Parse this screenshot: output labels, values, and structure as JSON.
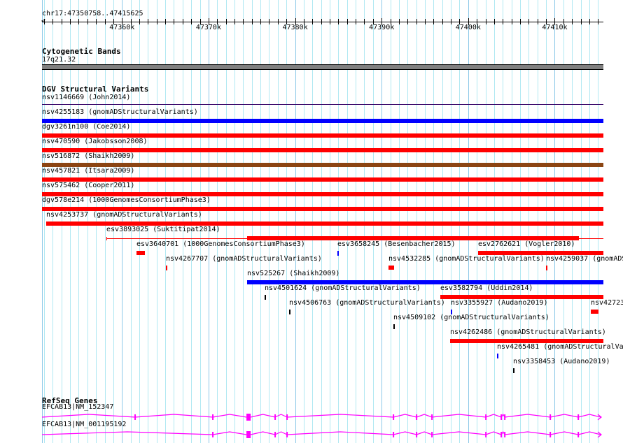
{
  "location": "chr17:47350758..47415625",
  "view": {
    "start": 47350758,
    "end": 47415625
  },
  "ruler": {
    "tick_labels": [
      "47360k",
      "47370k",
      "47380k",
      "47390k",
      "47400k",
      "47410k"
    ],
    "ticks_bp": [
      47360000,
      47370000,
      47380000,
      47390000,
      47400000,
      47410000
    ]
  },
  "colors": {
    "red": "#ff0000",
    "blue": "#0000ff",
    "brown": "#8b4513",
    "black": "#000000",
    "gray": "#808080",
    "gene": "#ff00ff",
    "thin": "#330066"
  },
  "cytoband": {
    "title": "Cytogenetic Bands",
    "band": "17q21.32"
  },
  "dgv": {
    "title": "DGV Structural Variants",
    "features": [
      {
        "label": "nsv1146669 (John2014)",
        "start": 47350758,
        "end": 47415625,
        "row": 0,
        "color": "thin",
        "style": "line"
      },
      {
        "label": "nsv4255183 (gnomADStructuralVariants)",
        "start": 47350758,
        "end": 47415625,
        "row": 1,
        "color": "blue"
      },
      {
        "label": "dgv3261n100 (Coe2014)",
        "start": 47350758,
        "end": 47415625,
        "row": 2,
        "color": "red"
      },
      {
        "label": "nsv470590 (Jakobsson2008)",
        "start": 47350758,
        "end": 47415625,
        "row": 3,
        "color": "red"
      },
      {
        "label": "nsv516872 (Shaikh2009)",
        "start": 47350758,
        "end": 47415625,
        "row": 4,
        "color": "brown"
      },
      {
        "label": "nsv457821 (Itsara2009)",
        "start": 47350758,
        "end": 47415625,
        "row": 5,
        "color": "red"
      },
      {
        "label": "nsv575462 (Cooper2011)",
        "start": 47350758,
        "end": 47415625,
        "row": 6,
        "color": "red"
      },
      {
        "label": "dgv578e214 (1000GenomesConsortiumPhase3)",
        "start": 47350758,
        "end": 47415625,
        "row": 7,
        "color": "red"
      },
      {
        "label": "nsv4253737 (gnomADStructuralVariants)",
        "start": 47351243,
        "end": 47415625,
        "row": 8,
        "color": "red"
      },
      {
        "label": "esv3893025 (Suktitipat2014)",
        "start": 47358201,
        "end": 47415625,
        "thick_start": 47374462,
        "thick_end": 47412808,
        "row": 9,
        "color": "red",
        "style": "thickthin"
      },
      {
        "label": "esv3640701 (1000GenomesConsortiumPhase3)",
        "start": 47361680,
        "end": 47362650,
        "row": 10,
        "color": "red"
      },
      {
        "label": "esv3658245 (Besenbacher2015)",
        "start": 47384898,
        "end": 47385060,
        "row": 10,
        "color": "blue"
      },
      {
        "label": "esv2762621 (Vogler2010)",
        "start": 47401159,
        "end": 47415625,
        "row": 10,
        "color": "red"
      },
      {
        "label": "nsv4267707 (gnomADStructuralVariants)",
        "start": 47365077,
        "end": 47365239,
        "row": 11,
        "color": "red"
      },
      {
        "label": "nsv4532285 (gnomADStructuralVariants)",
        "start": 47390804,
        "end": 47391451,
        "row": 11,
        "color": "red"
      },
      {
        "label": "nsv4259037 (gnomADS",
        "start": 47409006,
        "end": 47409168,
        "row": 11,
        "color": "red"
      },
      {
        "label": "nsv525267 (Shaikh2009)",
        "start": 47374462,
        "end": 47415625,
        "row": 12,
        "color": "blue"
      },
      {
        "label": "nsv4501624 (gnomADStructuralVariants)",
        "start": 47376484,
        "end": 47376646,
        "row": 13,
        "color": "black"
      },
      {
        "label": "esv3582794 (Uddin2014)",
        "start": 47396790,
        "end": 47415625,
        "row": 13,
        "color": "red"
      },
      {
        "label": "nsv4506763 (gnomADStructuralVariants)",
        "start": 47379316,
        "end": 47379478,
        "row": 14,
        "color": "black"
      },
      {
        "label": "nsv3355927 (Audano2019)",
        "start": 47398004,
        "end": 47398166,
        "row": 14,
        "color": "blue"
      },
      {
        "label": "nsv42723",
        "start": 47414184,
        "end": 47415074,
        "row": 14,
        "color": "red"
      },
      {
        "label": "nsv4509102 (gnomADStructuralVariants)",
        "start": 47391370,
        "end": 47391532,
        "row": 15,
        "color": "black"
      },
      {
        "label": "nsv4262486 (gnomADStructuralVariants)",
        "start": 47397923,
        "end": 47415625,
        "row": 16,
        "color": "red"
      },
      {
        "label": "nsv4265481 (gnomADStructuralVa",
        "start": 47403343,
        "end": 47403505,
        "row": 17,
        "color": "blue"
      },
      {
        "label": "nsv3358453 (Audano2019)",
        "start": 47405204,
        "end": 47405366,
        "row": 18,
        "color": "black"
      }
    ]
  },
  "refseq": {
    "title": "RefSeq Genes",
    "transcripts": [
      {
        "label": "EFCAB13|NM_152347",
        "start": 47350758,
        "end": 47415300,
        "exons": [
          47361518,
          47370498,
          [
            47374381,
            47374866
          ],
          47377698,
          47379073,
          47391370,
          47394040,
          47395819,
          47402049,
          47403828,
          47404233,
          47409491,
          47412727
        ]
      },
      {
        "label": "EFCAB13|NM_001195192",
        "start": 47350758,
        "end": 47415300,
        "exons": [
          47370498,
          [
            47374381,
            47374866
          ],
          47377698,
          47379073,
          47391370,
          47394040,
          47395819,
          47402049,
          47403828,
          47404233,
          47409491,
          47412727
        ]
      }
    ]
  }
}
